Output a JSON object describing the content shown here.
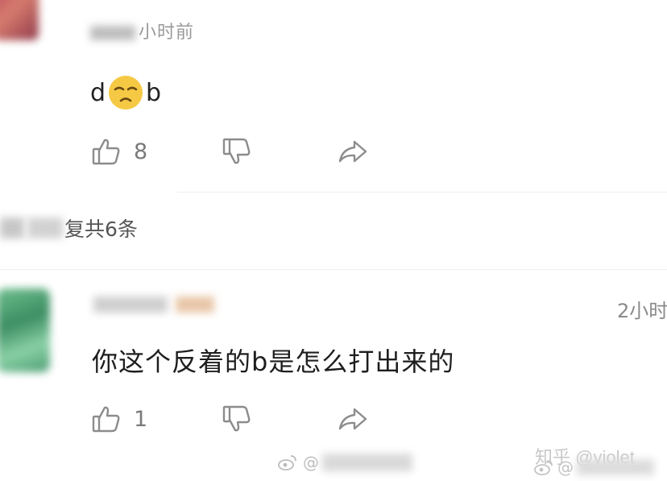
{
  "comment1": {
    "time_label": "小时前",
    "content_left": "d",
    "content_right": "b",
    "emoji_icon": "pensive-face-emoji",
    "like_count": "8"
  },
  "replies": {
    "summary_label": "复共6条"
  },
  "comment2": {
    "time_label": "2小时",
    "content": "你这个反着的b是怎么打出来的",
    "like_count": "1"
  },
  "watermarks": {
    "weibo_prefix": "@",
    "zhihu_label": "知乎 @violet_",
    "bottom_prefix": "@"
  },
  "colors": {
    "icon_gray": "#8c8c8c",
    "emoji_yellow": "#f6c945"
  }
}
